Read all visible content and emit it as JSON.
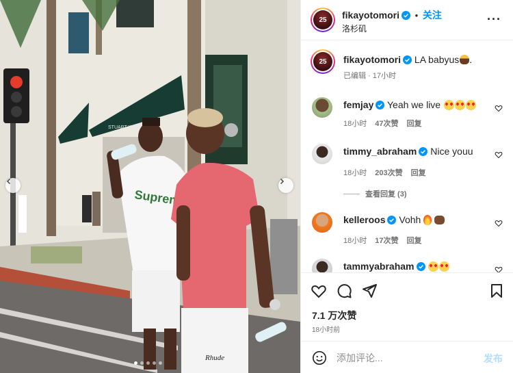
{
  "post": {
    "author": "fikayotomori",
    "follow_label": "关注",
    "location": "洛杉矶",
    "more_icon": "more-horizontal-icon",
    "avatar_number": "25",
    "caption_text": "LA babyus",
    "caption_suffix": ".",
    "edited_label": "已编辑",
    "caption_time": "17小时",
    "likes": "7.1 万次赞",
    "posted_time": "18小时前",
    "photo_sign_text": "STUART WEITZMAN",
    "shirt_text": "Supreme"
  },
  "comments": [
    {
      "user": "femjay",
      "text": "Yeah we live",
      "time": "18小时",
      "likes": "47次赞",
      "reply": "回复"
    },
    {
      "user": "timmy_abraham",
      "text": "Nice youu",
      "time": "18小时",
      "likes": "203次赞",
      "reply": "回复",
      "view_replies": "查看回复 (3)"
    },
    {
      "user": "kelleroos",
      "text": "Vohh",
      "time": "18小时",
      "likes": "17次赞",
      "reply": "回复"
    },
    {
      "user": "tammyabraham",
      "text": ""
    }
  ],
  "composer": {
    "placeholder": "添加评论...",
    "post_label": "发布"
  },
  "carousel": {
    "slides": 5,
    "active_index": 0
  },
  "colors": {
    "accent": "#0095f6",
    "verified": "#0095f6",
    "muted": "#737373"
  }
}
